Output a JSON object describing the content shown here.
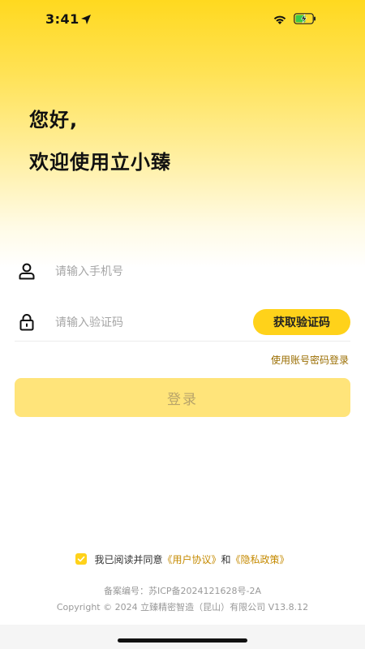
{
  "status_bar": {
    "time": "3:41",
    "icons": [
      "location-arrow-icon",
      "wifi-icon",
      "battery-charging-icon"
    ]
  },
  "greeting": {
    "line1": "您好,",
    "line2": "欢迎使用立小臻"
  },
  "form": {
    "phone_placeholder": "请输入手机号",
    "code_placeholder": "请输入验证码",
    "get_code_label": "获取验证码",
    "password_login_link": "使用账号密码登录",
    "login_label": "登录"
  },
  "agreement": {
    "prefix": "我已阅读并同意",
    "user_agreement": "《用户协议》",
    "and": "和",
    "privacy_policy": "《隐私政策》",
    "checked": true
  },
  "footer": {
    "record": "备案编号：苏ICP备2024121628号-2A",
    "copyright": "Copyright © 2024 立臻精密智造（昆山）有限公司 V13.8.12"
  },
  "colors": {
    "accent": "#ffd21a",
    "login_button": "#ffe47a",
    "link": "#c58a00"
  }
}
